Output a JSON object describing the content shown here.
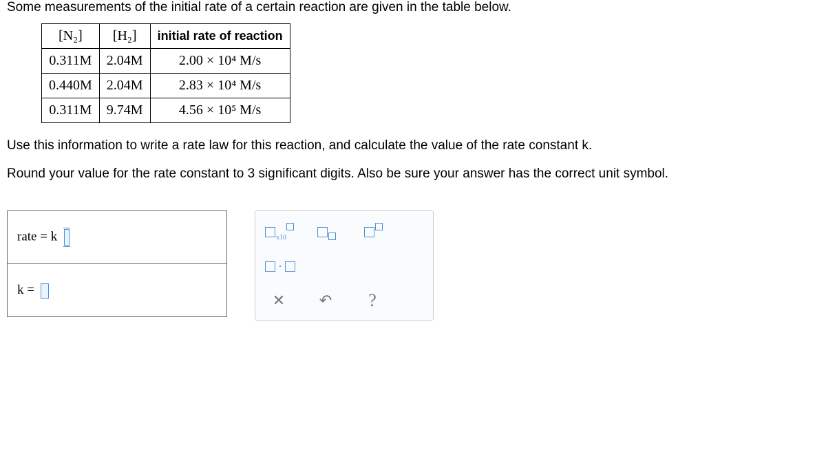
{
  "intro": "Some measurements of the initial rate of a certain reaction are given in the table below.",
  "table": {
    "headers": {
      "col1": "[N₂]",
      "col2": "[H₂]",
      "col3": "initial rate of reaction"
    },
    "rows": [
      {
        "n2": "0.311M",
        "h2": "2.04M",
        "rate": "2.00 × 10⁴ M/s"
      },
      {
        "n2": "0.440M",
        "h2": "2.04M",
        "rate": "2.83 × 10⁴ M/s"
      },
      {
        "n2": "0.311M",
        "h2": "9.74M",
        "rate": "4.56 × 10⁵ M/s"
      }
    ]
  },
  "instruction1": "Use this information to write a rate law for this reaction, and calculate the value of the rate constant k.",
  "instruction2": "Round your value for the rate constant to 3 significant digits. Also be sure your answer has the correct unit symbol.",
  "answer": {
    "rate_label": "rate = k",
    "k_label": "k ="
  },
  "palette": {
    "sci_label": "x10",
    "clear": "✕",
    "undo": "↶",
    "help": "?"
  }
}
